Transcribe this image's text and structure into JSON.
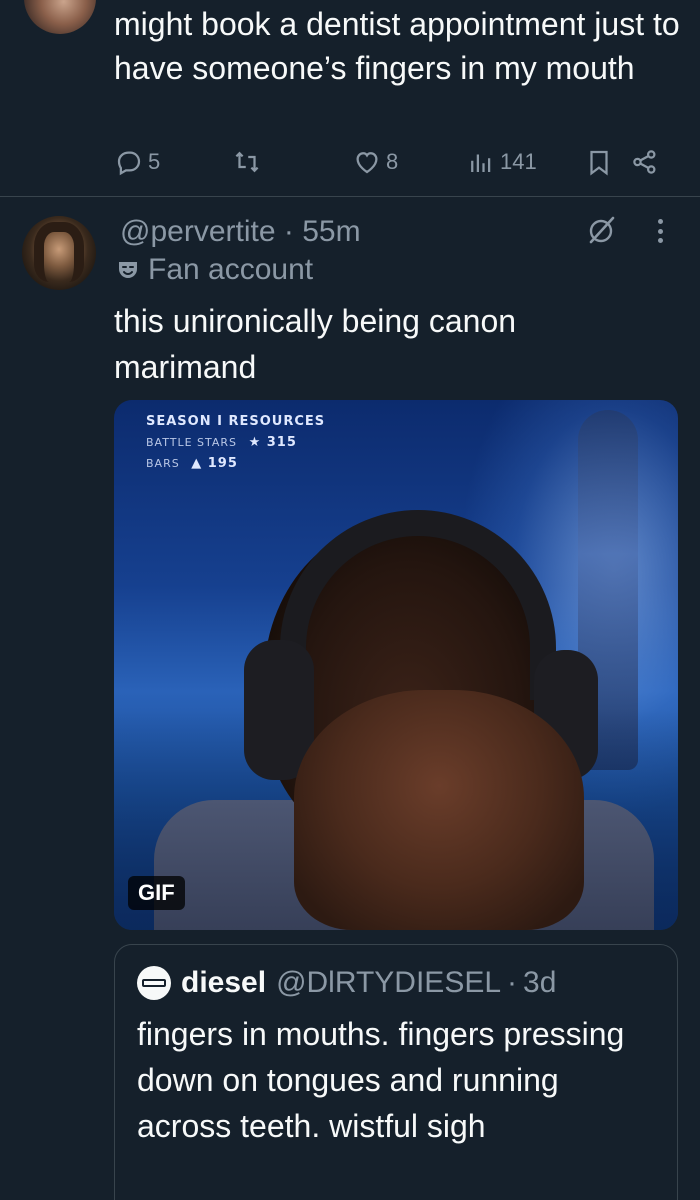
{
  "previous_tweet": {
    "text": "might book a dentist appointment just to have someone’s fingers in my mouth",
    "actions": {
      "replies": "5",
      "likes": "8",
      "views": "141"
    }
  },
  "tweet": {
    "handle": "@pervertite",
    "separator": "·",
    "time": "55m",
    "badge_label": "Fan account",
    "text_line1": "this unironically being canon",
    "text_line2": "marimand",
    "media": {
      "type_badge": "GIF",
      "hud": {
        "line1": "SEASON I RESOURCES",
        "line2_label": "BATTLE STARS",
        "line2_value": "315",
        "line3_label": "BARS",
        "line3_value": "195"
      }
    },
    "quote": {
      "name": "diesel",
      "handle": "@DlRTYDIESEL",
      "separator": "·",
      "time": "3d",
      "text": "fingers in mouths. fingers pressing down on tongues and running across teeth. wistful sigh"
    }
  },
  "colors": {
    "background": "#15202b",
    "text": "#f7f9f9",
    "secondary": "#8b98a5",
    "border": "#38444d"
  }
}
